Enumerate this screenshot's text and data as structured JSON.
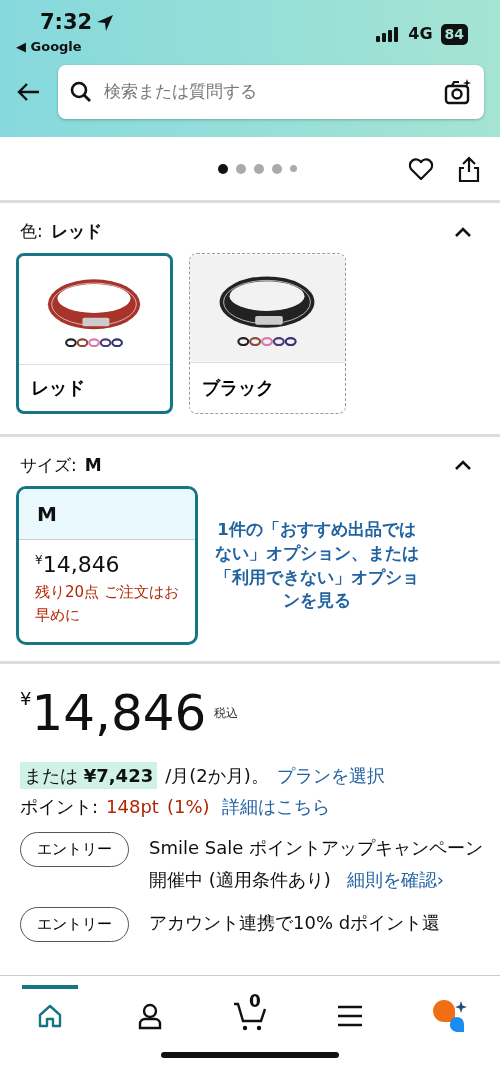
{
  "status_bar": {
    "time": "7:32",
    "back_app": "◀ Google",
    "network": "4G",
    "battery": "84"
  },
  "search": {
    "placeholder": "検索または質問する"
  },
  "carousel": {
    "dots": [
      {
        "selected": true
      },
      {
        "selected": false
      },
      {
        "selected": false
      },
      {
        "selected": false
      },
      {
        "selected": false
      }
    ]
  },
  "color_selector": {
    "label": "色:",
    "value": "レッド",
    "expanded": true,
    "options": [
      {
        "label": "レッド",
        "selected": true,
        "available": true
      },
      {
        "label": "ブラック",
        "selected": false,
        "available": false
      }
    ]
  },
  "size_selector": {
    "label": "サイズ:",
    "value": "M",
    "expanded": true,
    "options": [
      {
        "label": "M",
        "price_symbol": "¥",
        "price": "14,846",
        "stock_note": "残り20点 ご注文はお早めに",
        "selected": true
      }
    ],
    "other_options_link": "1件の「おすすめ出品ではない」オプション、または「利用できない」オプションを見る"
  },
  "price": {
    "symbol": "¥",
    "amount": "14,846",
    "tax_note": "税込"
  },
  "installment": {
    "prefix": "または",
    "amount": "¥7,423",
    "suffix": "/月(2か月)。",
    "link": "プランを選択"
  },
  "points": {
    "label": "ポイント:",
    "value": "148pt",
    "rate": "(1%)",
    "link": "詳細はこちら"
  },
  "promotions": [
    {
      "button": "エントリー",
      "text": "Smile Sale ポイントアップキャンペーン開催中 (適用条件あり)",
      "link": "細則を確認›"
    },
    {
      "button": "エントリー",
      "text": "アカウント連携で10% dポイント還"
    }
  ],
  "bottom_nav": {
    "items": [
      {
        "kind": "home",
        "selected": true
      },
      {
        "kind": "account",
        "selected": false
      },
      {
        "kind": "cart",
        "selected": false,
        "badge": "0"
      },
      {
        "kind": "menu",
        "selected": false
      },
      {
        "kind": "assistant",
        "selected": false
      }
    ]
  }
}
